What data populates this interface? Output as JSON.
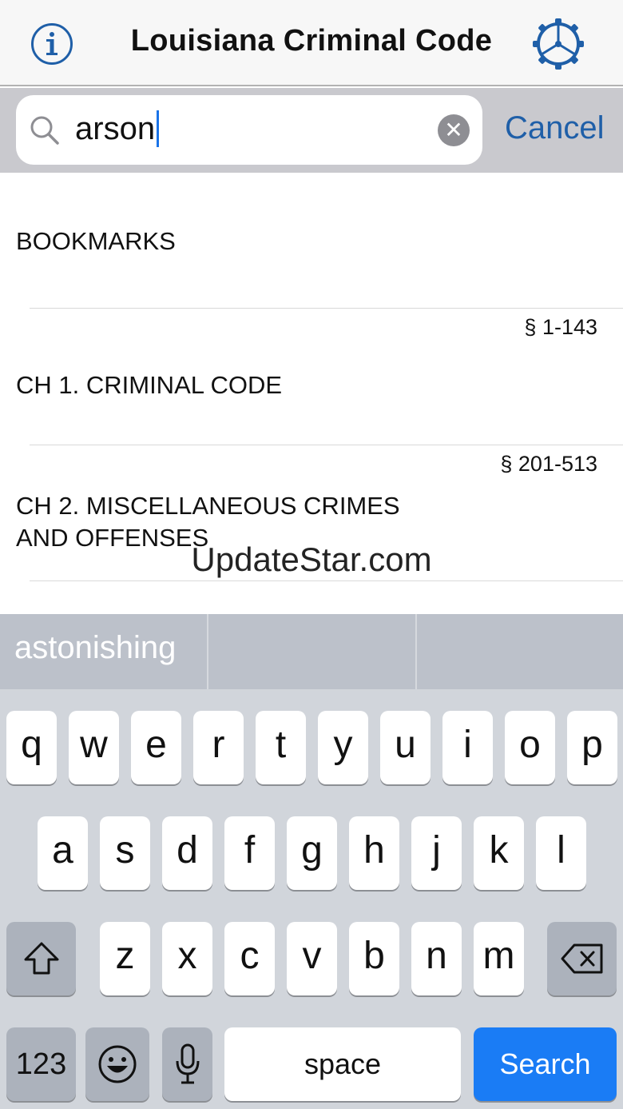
{
  "header": {
    "title": "Louisiana Criminal Code",
    "left_icon": "info-icon",
    "right_icon": "gear-icon"
  },
  "search": {
    "value": "arson",
    "clear_icon": "clear-icon",
    "cancel_label": "Cancel"
  },
  "list": {
    "items": [
      {
        "label": "BOOKMARKS",
        "range": ""
      },
      {
        "label": "CH 1. CRIMINAL CODE",
        "range": "§ 1-143"
      },
      {
        "label": "CH 2. MISCELLANEOUS CRIMES AND OFFENSES",
        "label_line1": "CH 2. MISCELLANEOUS CRIMES",
        "label_line2": "AND OFFENSES",
        "range": "§ 201-513"
      }
    ]
  },
  "watermark": "UpdateStar.com",
  "keyboard": {
    "suggestions": [
      "astonishing",
      "",
      ""
    ],
    "row1": [
      "q",
      "w",
      "e",
      "r",
      "t",
      "y",
      "u",
      "i",
      "o",
      "p"
    ],
    "row2": [
      "a",
      "s",
      "d",
      "f",
      "g",
      "h",
      "j",
      "k",
      "l"
    ],
    "row3": [
      "z",
      "x",
      "c",
      "v",
      "b",
      "n",
      "m"
    ],
    "numbers_label": "123",
    "space_label": "space",
    "search_label": "Search",
    "accent_color": "#1a7cf5"
  }
}
